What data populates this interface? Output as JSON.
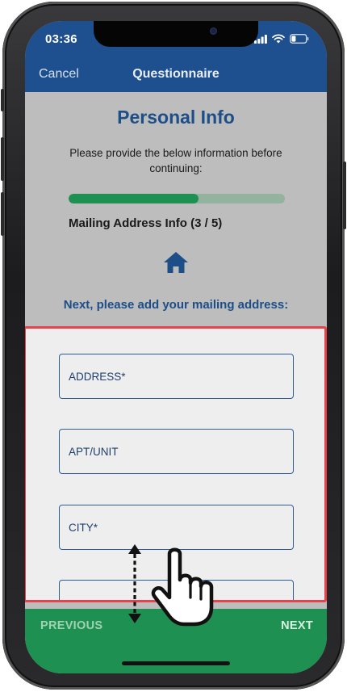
{
  "status_bar": {
    "time": "03:36",
    "icons": [
      "cellular-signal-icon",
      "wifi-icon",
      "battery-icon"
    ]
  },
  "nav": {
    "cancel_label": "Cancel",
    "title": "Questionnaire"
  },
  "main": {
    "title": "Personal Info",
    "instructions": "Please provide the below information before continuing:",
    "progress": {
      "fraction": 0.6,
      "label": "Mailing Address Info (3 / 5)"
    },
    "section_icon": "home-icon",
    "prompt": "Next, please add your mailing address:"
  },
  "form": {
    "fields": [
      {
        "placeholder": "ADDRESS*",
        "value": ""
      },
      {
        "placeholder": "APT/UNIT",
        "value": ""
      },
      {
        "placeholder": "CITY*",
        "value": ""
      },
      {
        "placeholder": "",
        "value": ""
      }
    ]
  },
  "footer": {
    "previous_label": "PREVIOUS",
    "next_label": "NEXT"
  },
  "gesture": {
    "icon": "hand-swipe-vertical-icon"
  },
  "colors": {
    "header_blue": "#1e4f8f",
    "title_blue": "#1d4e88",
    "footer_green": "#1e9152",
    "progress_fill": "#1e9152",
    "progress_track": "#93b39f",
    "highlight_border": "#e8424a",
    "screen_gray": "#bdbdbd",
    "form_background": "#eeeeee"
  }
}
